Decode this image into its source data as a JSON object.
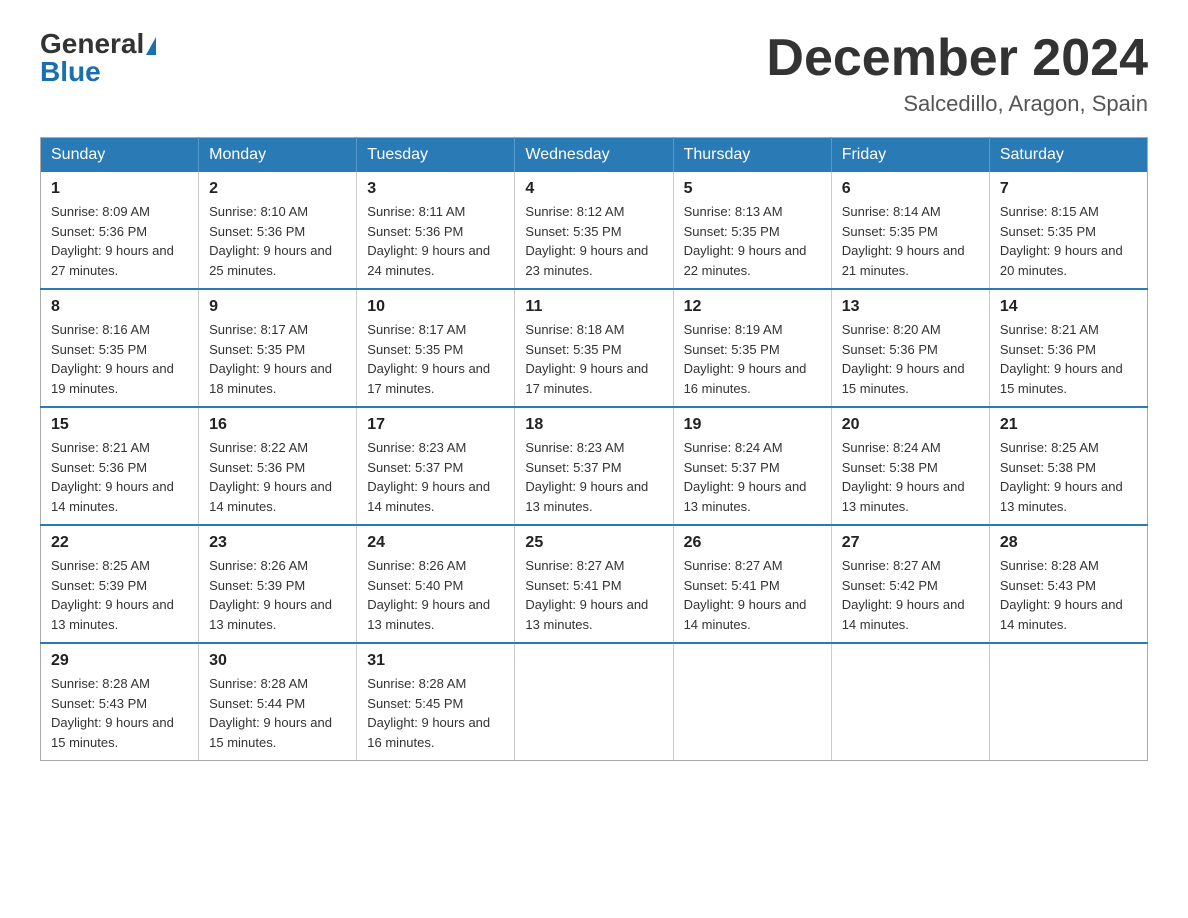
{
  "logo": {
    "general": "General",
    "blue": "Blue"
  },
  "header": {
    "month_year": "December 2024",
    "location": "Salcedillo, Aragon, Spain"
  },
  "days_of_week": [
    "Sunday",
    "Monday",
    "Tuesday",
    "Wednesday",
    "Thursday",
    "Friday",
    "Saturday"
  ],
  "weeks": [
    [
      {
        "day": "1",
        "sunrise": "8:09 AM",
        "sunset": "5:36 PM",
        "daylight": "9 hours and 27 minutes."
      },
      {
        "day": "2",
        "sunrise": "8:10 AM",
        "sunset": "5:36 PM",
        "daylight": "9 hours and 25 minutes."
      },
      {
        "day": "3",
        "sunrise": "8:11 AM",
        "sunset": "5:36 PM",
        "daylight": "9 hours and 24 minutes."
      },
      {
        "day": "4",
        "sunrise": "8:12 AM",
        "sunset": "5:35 PM",
        "daylight": "9 hours and 23 minutes."
      },
      {
        "day": "5",
        "sunrise": "8:13 AM",
        "sunset": "5:35 PM",
        "daylight": "9 hours and 22 minutes."
      },
      {
        "day": "6",
        "sunrise": "8:14 AM",
        "sunset": "5:35 PM",
        "daylight": "9 hours and 21 minutes."
      },
      {
        "day": "7",
        "sunrise": "8:15 AM",
        "sunset": "5:35 PM",
        "daylight": "9 hours and 20 minutes."
      }
    ],
    [
      {
        "day": "8",
        "sunrise": "8:16 AM",
        "sunset": "5:35 PM",
        "daylight": "9 hours and 19 minutes."
      },
      {
        "day": "9",
        "sunrise": "8:17 AM",
        "sunset": "5:35 PM",
        "daylight": "9 hours and 18 minutes."
      },
      {
        "day": "10",
        "sunrise": "8:17 AM",
        "sunset": "5:35 PM",
        "daylight": "9 hours and 17 minutes."
      },
      {
        "day": "11",
        "sunrise": "8:18 AM",
        "sunset": "5:35 PM",
        "daylight": "9 hours and 17 minutes."
      },
      {
        "day": "12",
        "sunrise": "8:19 AM",
        "sunset": "5:35 PM",
        "daylight": "9 hours and 16 minutes."
      },
      {
        "day": "13",
        "sunrise": "8:20 AM",
        "sunset": "5:36 PM",
        "daylight": "9 hours and 15 minutes."
      },
      {
        "day": "14",
        "sunrise": "8:21 AM",
        "sunset": "5:36 PM",
        "daylight": "9 hours and 15 minutes."
      }
    ],
    [
      {
        "day": "15",
        "sunrise": "8:21 AM",
        "sunset": "5:36 PM",
        "daylight": "9 hours and 14 minutes."
      },
      {
        "day": "16",
        "sunrise": "8:22 AM",
        "sunset": "5:36 PM",
        "daylight": "9 hours and 14 minutes."
      },
      {
        "day": "17",
        "sunrise": "8:23 AM",
        "sunset": "5:37 PM",
        "daylight": "9 hours and 14 minutes."
      },
      {
        "day": "18",
        "sunrise": "8:23 AM",
        "sunset": "5:37 PM",
        "daylight": "9 hours and 13 minutes."
      },
      {
        "day": "19",
        "sunrise": "8:24 AM",
        "sunset": "5:37 PM",
        "daylight": "9 hours and 13 minutes."
      },
      {
        "day": "20",
        "sunrise": "8:24 AM",
        "sunset": "5:38 PM",
        "daylight": "9 hours and 13 minutes."
      },
      {
        "day": "21",
        "sunrise": "8:25 AM",
        "sunset": "5:38 PM",
        "daylight": "9 hours and 13 minutes."
      }
    ],
    [
      {
        "day": "22",
        "sunrise": "8:25 AM",
        "sunset": "5:39 PM",
        "daylight": "9 hours and 13 minutes."
      },
      {
        "day": "23",
        "sunrise": "8:26 AM",
        "sunset": "5:39 PM",
        "daylight": "9 hours and 13 minutes."
      },
      {
        "day": "24",
        "sunrise": "8:26 AM",
        "sunset": "5:40 PM",
        "daylight": "9 hours and 13 minutes."
      },
      {
        "day": "25",
        "sunrise": "8:27 AM",
        "sunset": "5:41 PM",
        "daylight": "9 hours and 13 minutes."
      },
      {
        "day": "26",
        "sunrise": "8:27 AM",
        "sunset": "5:41 PM",
        "daylight": "9 hours and 14 minutes."
      },
      {
        "day": "27",
        "sunrise": "8:27 AM",
        "sunset": "5:42 PM",
        "daylight": "9 hours and 14 minutes."
      },
      {
        "day": "28",
        "sunrise": "8:28 AM",
        "sunset": "5:43 PM",
        "daylight": "9 hours and 14 minutes."
      }
    ],
    [
      {
        "day": "29",
        "sunrise": "8:28 AM",
        "sunset": "5:43 PM",
        "daylight": "9 hours and 15 minutes."
      },
      {
        "day": "30",
        "sunrise": "8:28 AM",
        "sunset": "5:44 PM",
        "daylight": "9 hours and 15 minutes."
      },
      {
        "day": "31",
        "sunrise": "8:28 AM",
        "sunset": "5:45 PM",
        "daylight": "9 hours and 16 minutes."
      },
      null,
      null,
      null,
      null
    ]
  ]
}
